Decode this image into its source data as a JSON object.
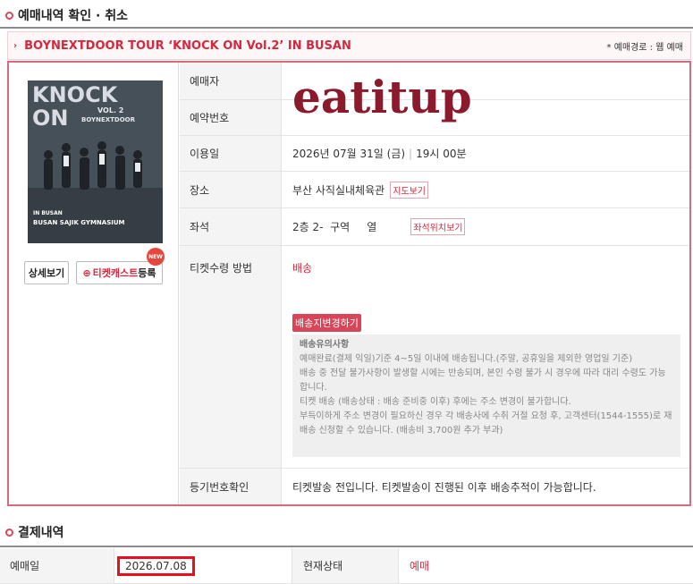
{
  "section1_title": "예매내역 확인 · 취소",
  "show": {
    "title": "BOYNEXTDOOR TOUR ‘KNOCK ON Vol.2’ IN BUSAN",
    "route": "* 예매경로 : 웹 예매"
  },
  "poster": {
    "line1": "KNOCK",
    "line2": "ON",
    "vol": "VOL. 2",
    "artist": "BOYNEXTDOOR",
    "city": "IN BUSAN",
    "venue": "BUSAN SAJIK GYMNASIUM"
  },
  "buttons": {
    "detail": "상세보기",
    "ticketcast_red": "티켓캐스트",
    "ticketcast_suffix": "등록",
    "new_badge": "NEW",
    "map": "지도보기",
    "seatmap": "좌석위치보기",
    "change_address": "배송지변경하기"
  },
  "rows": {
    "booker_label": "예매자",
    "booking_no_label": "예약번호",
    "date_label": "이용일",
    "date_value": "2026년 07월 31일 (금)",
    "time_value": "19시 00분",
    "venue_label": "장소",
    "venue_value": "부산 사직실내체육관",
    "seat_label": "좌석",
    "seat_value": "2층 2-  구역     열",
    "receive_label": "티켓수령 방법",
    "receive_value": "배송",
    "reg_label": "등기번호확인",
    "reg_value": "티켓발송 전입니다. 티켓발송이 진행된 이후 배송추적이 가능합니다."
  },
  "notice": {
    "title": "배송유의사항",
    "line1": "예매완료(결제 익일)기준 4~5일 이내에 배송됩니다.(주말, 공휴일을 제외한 영업일 기준)",
    "line2": "배송 중 전달 불가사항이 발생할 시에는 반송되며, 본인 수령 불가 시 경우에 따라 대리 수령도 가능합니다.",
    "line3": "티켓 배송 (배송상태 : 배송 준비중 이후) 후에는 주소 변경이 불가합니다.",
    "line4": "부득이하게 주소 변경이 필요하신 경우 각 배송사에 수취 거절 요청 후, 고객센터(1544-1555)로 재배송 신청할 수 있습니다. (배송비 3,700원 추가 부과)"
  },
  "watermark": "eatitup",
  "section2_title": "결제내역",
  "payment": {
    "date_label": "예매일",
    "date_value": "2026.07.08",
    "status_label": "현재상태",
    "status_value": "예매"
  },
  "colors": {
    "accent": "#d4283e",
    "border_accent": "#d36d7c",
    "highlight_box": "#e8101e"
  }
}
